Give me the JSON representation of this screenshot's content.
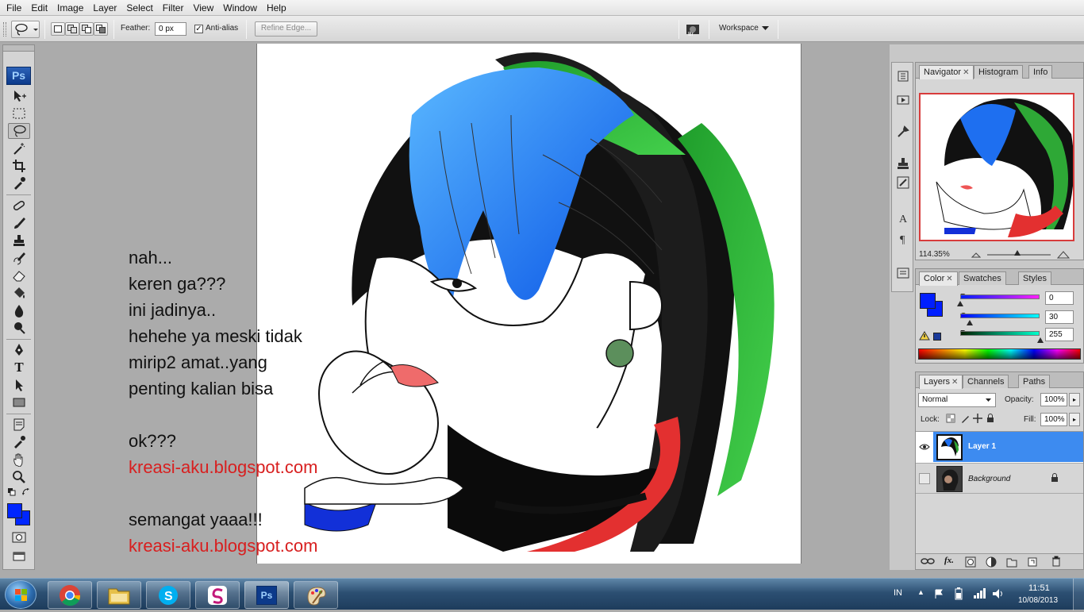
{
  "menu": [
    "File",
    "Edit",
    "Image",
    "Layer",
    "Select",
    "Filter",
    "View",
    "Window",
    "Help"
  ],
  "options": {
    "feather_label": "Feather:",
    "feather_value": "0 px",
    "antialias_label": "Anti-alias",
    "refine_label": "Refine Edge...",
    "workspace_label": "Workspace"
  },
  "toolbox": {
    "logo": "Ps",
    "tools": [
      "move-tool",
      "marquee-tool",
      "lasso-tool",
      "magic-wand-tool",
      "crop-tool",
      "eyedropper-tool",
      "healing-brush-tool",
      "brush-tool",
      "clone-stamp-tool",
      "history-brush-tool",
      "eraser-tool",
      "paint-bucket-tool",
      "blur-tool",
      "dodge-tool",
      "pen-tool",
      "type-tool",
      "path-selection-tool",
      "shape-tool",
      "notes-tool",
      "eyedropper2-tool",
      "hand-tool",
      "zoom-tool"
    ],
    "foreground_color": "#0026ff",
    "background_color": "#0026ff",
    "type_glyph": "T"
  },
  "overlay_text": {
    "lines": [
      "nah...",
      "keren ga???",
      "ini jadinya..",
      "hehehe ya meski tidak",
      "mirip2 amat..yang",
      "penting kalian bisa",
      "",
      "ok???",
      "kreasi-aku.blogspot.com",
      "",
      "semangat yaaa!!!",
      "kreasi-aku.blogspot.com"
    ],
    "link_color": "#d81f1f"
  },
  "navigator": {
    "tabs": [
      "Navigator",
      "Histogram",
      "Info"
    ],
    "zoom": "114.35%"
  },
  "color_panel": {
    "tabs": [
      "Color",
      "Swatches",
      "Styles"
    ],
    "r_label": "R",
    "r_value": "0",
    "g_label": "G",
    "g_value": "30",
    "b_label": "B",
    "b_value": "255",
    "swatch_color": "#001eff"
  },
  "layers_panel": {
    "tabs": [
      "Layers",
      "Channels",
      "Paths"
    ],
    "blend_mode": "Normal",
    "opacity_label": "Opacity:",
    "opacity_value": "100%",
    "lock_label": "Lock:",
    "fill_label": "Fill:",
    "fill_value": "100%",
    "layers": [
      {
        "name": "Layer 1",
        "selected": true,
        "visible": true
      },
      {
        "name": "Background",
        "selected": false,
        "visible": false,
        "locked": true
      }
    ]
  },
  "taskbar": {
    "apps": [
      "start-orb",
      "chrome",
      "explorer",
      "skype",
      "app-s",
      "photoshop",
      "paint"
    ],
    "lang": "IN",
    "time": "11:51",
    "date": "10/08/2013"
  }
}
